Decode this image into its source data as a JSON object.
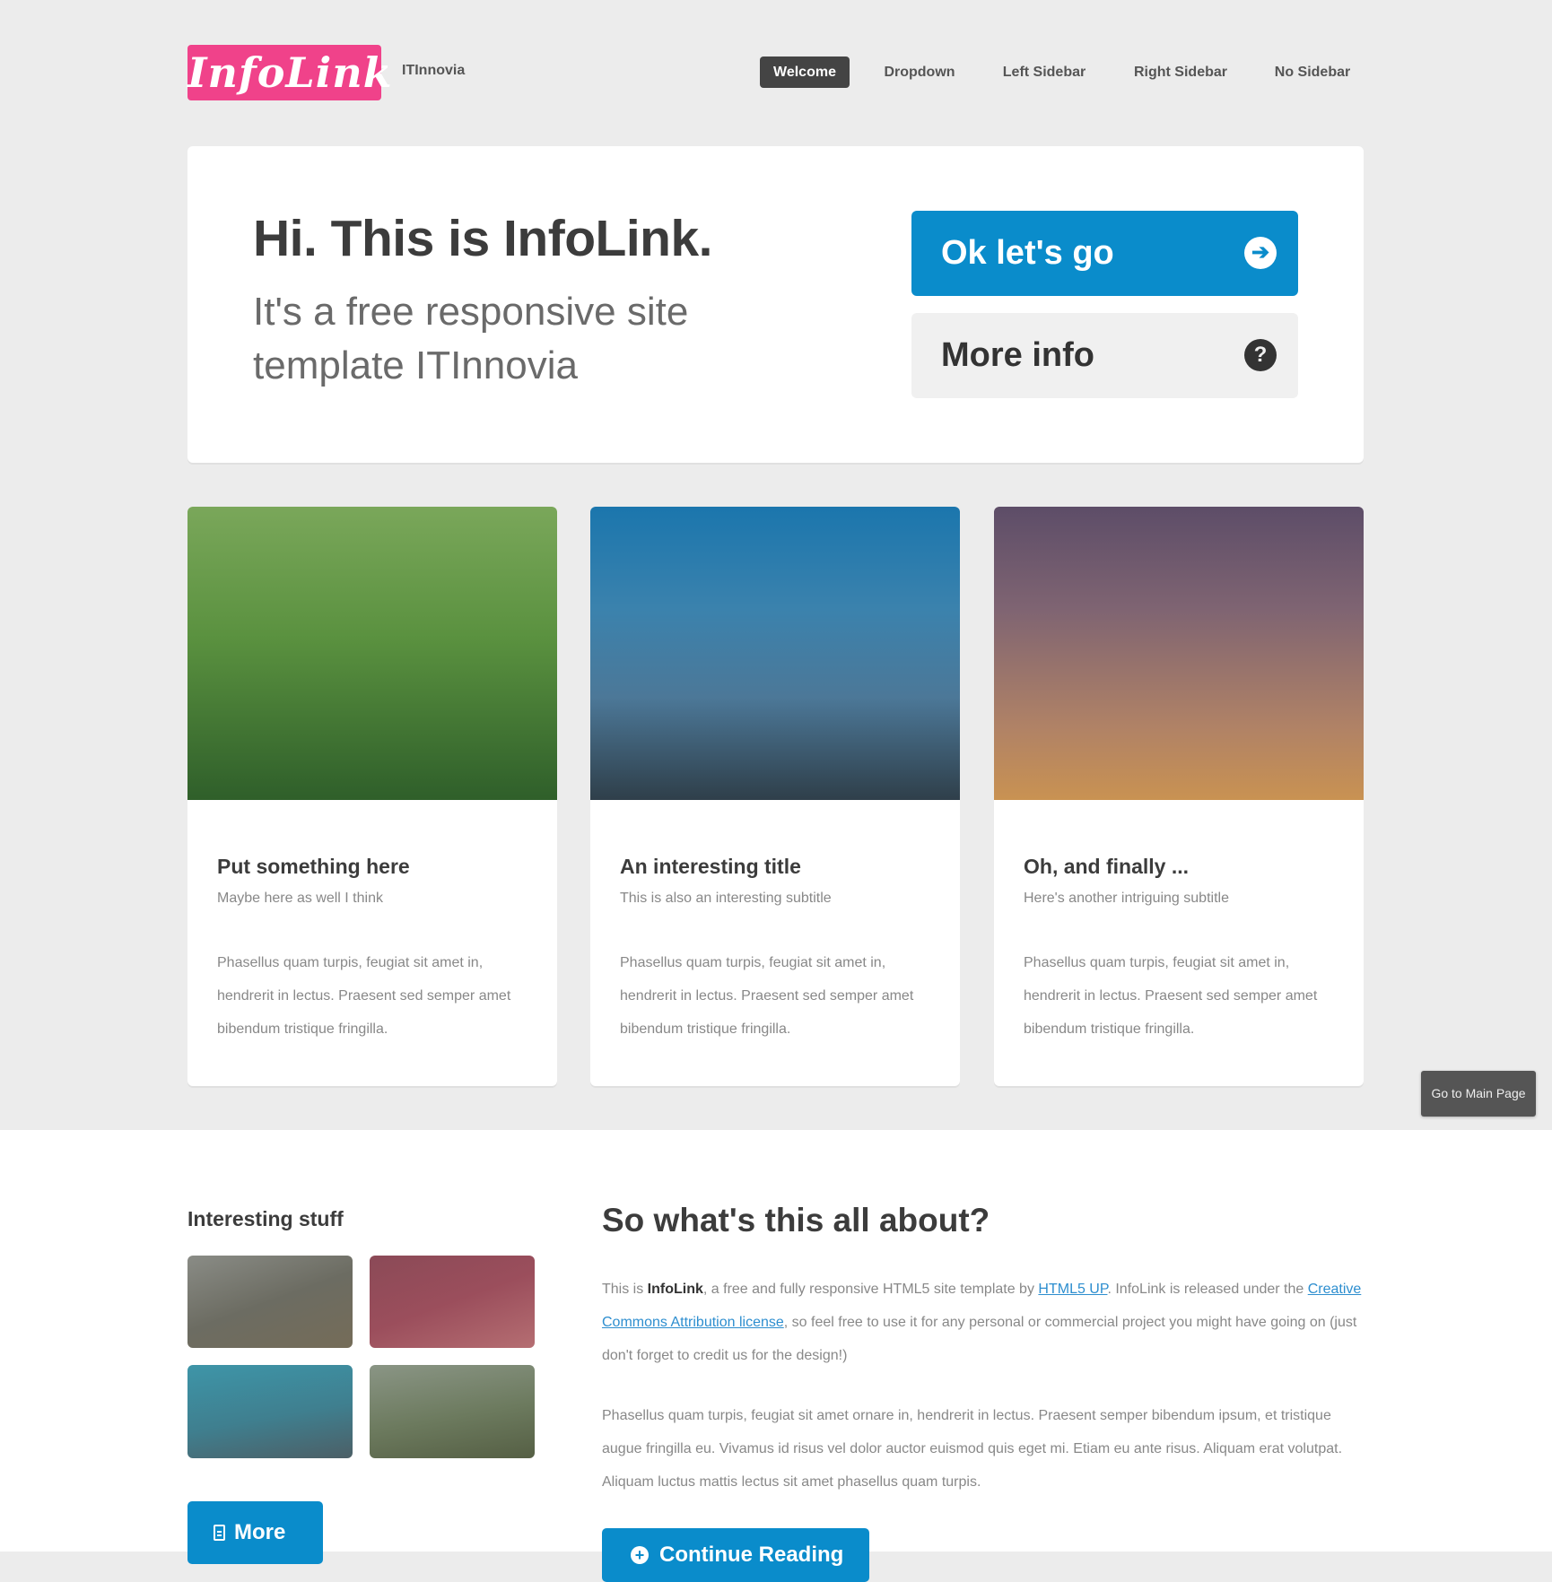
{
  "header": {
    "logo": "InfoLink",
    "brand_sub": "ITInnovia",
    "nav": [
      {
        "label": "Welcome",
        "active": true
      },
      {
        "label": "Dropdown",
        "active": false
      },
      {
        "label": "Left Sidebar",
        "active": false
      },
      {
        "label": "Right Sidebar",
        "active": false
      },
      {
        "label": "No Sidebar",
        "active": false
      }
    ]
  },
  "banner": {
    "title": "Hi. This is InfoLink.",
    "subtitle": "It's a free responsive site template ITInnovia",
    "primary_button": "Ok let's go",
    "secondary_button": "More info"
  },
  "cards": [
    {
      "title": "Put something here",
      "subtitle": "Maybe here as well I think",
      "text": "Phasellus quam turpis, feugiat sit amet in, hendrerit in lectus. Praesent sed semper amet bibendum tristique fringilla."
    },
    {
      "title": "An interesting title",
      "subtitle": "This is also an interesting subtitle",
      "text": "Phasellus quam turpis, feugiat sit amet in, hendrerit in lectus. Praesent sed semper amet bibendum tristique fringilla."
    },
    {
      "title": "Oh, and finally ...",
      "subtitle": "Here's another intriguing subtitle",
      "text": "Phasellus quam turpis, feugiat sit amet in, hendrerit in lectus. Praesent sed semper amet bibendum tristique fringilla."
    }
  ],
  "goto_main": "Go to Main Page",
  "sidebar": {
    "title": "Interesting stuff",
    "more_button": "More"
  },
  "about": {
    "title": "So what's this all about?",
    "p1_a": "This is ",
    "p1_b": "InfoLink",
    "p1_c": ", a free and fully responsive HTML5 site template by ",
    "p1_link1": "HTML5 UP",
    "p1_d": ". InfoLink is released under the ",
    "p1_link2": "Creative Commons Attribution license",
    "p1_e": ", so feel free to use it for any personal or commercial project you might have going on (just don't forget to credit us for the design!)",
    "p2": "Phasellus quam turpis, feugiat sit amet ornare in, hendrerit in lectus. Praesent semper bibendum ipsum, et tristique augue fringilla eu. Vivamus id risus vel dolor auctor euismod quis eget mi. Etiam eu ante risus. Aliquam erat volutpat. Aliquam luctus mattis lectus sit amet phasellus quam turpis.",
    "continue_button": "Continue Reading"
  },
  "colors": {
    "accent": "#0a8ccb",
    "logo": "#f0428a",
    "nav_active": "#444444"
  },
  "icons": {
    "primary_button": "arrow-right-circle-icon",
    "secondary_button": "question-circle-icon",
    "more_button": "document-icon",
    "continue_button": "plus-circle-icon"
  }
}
